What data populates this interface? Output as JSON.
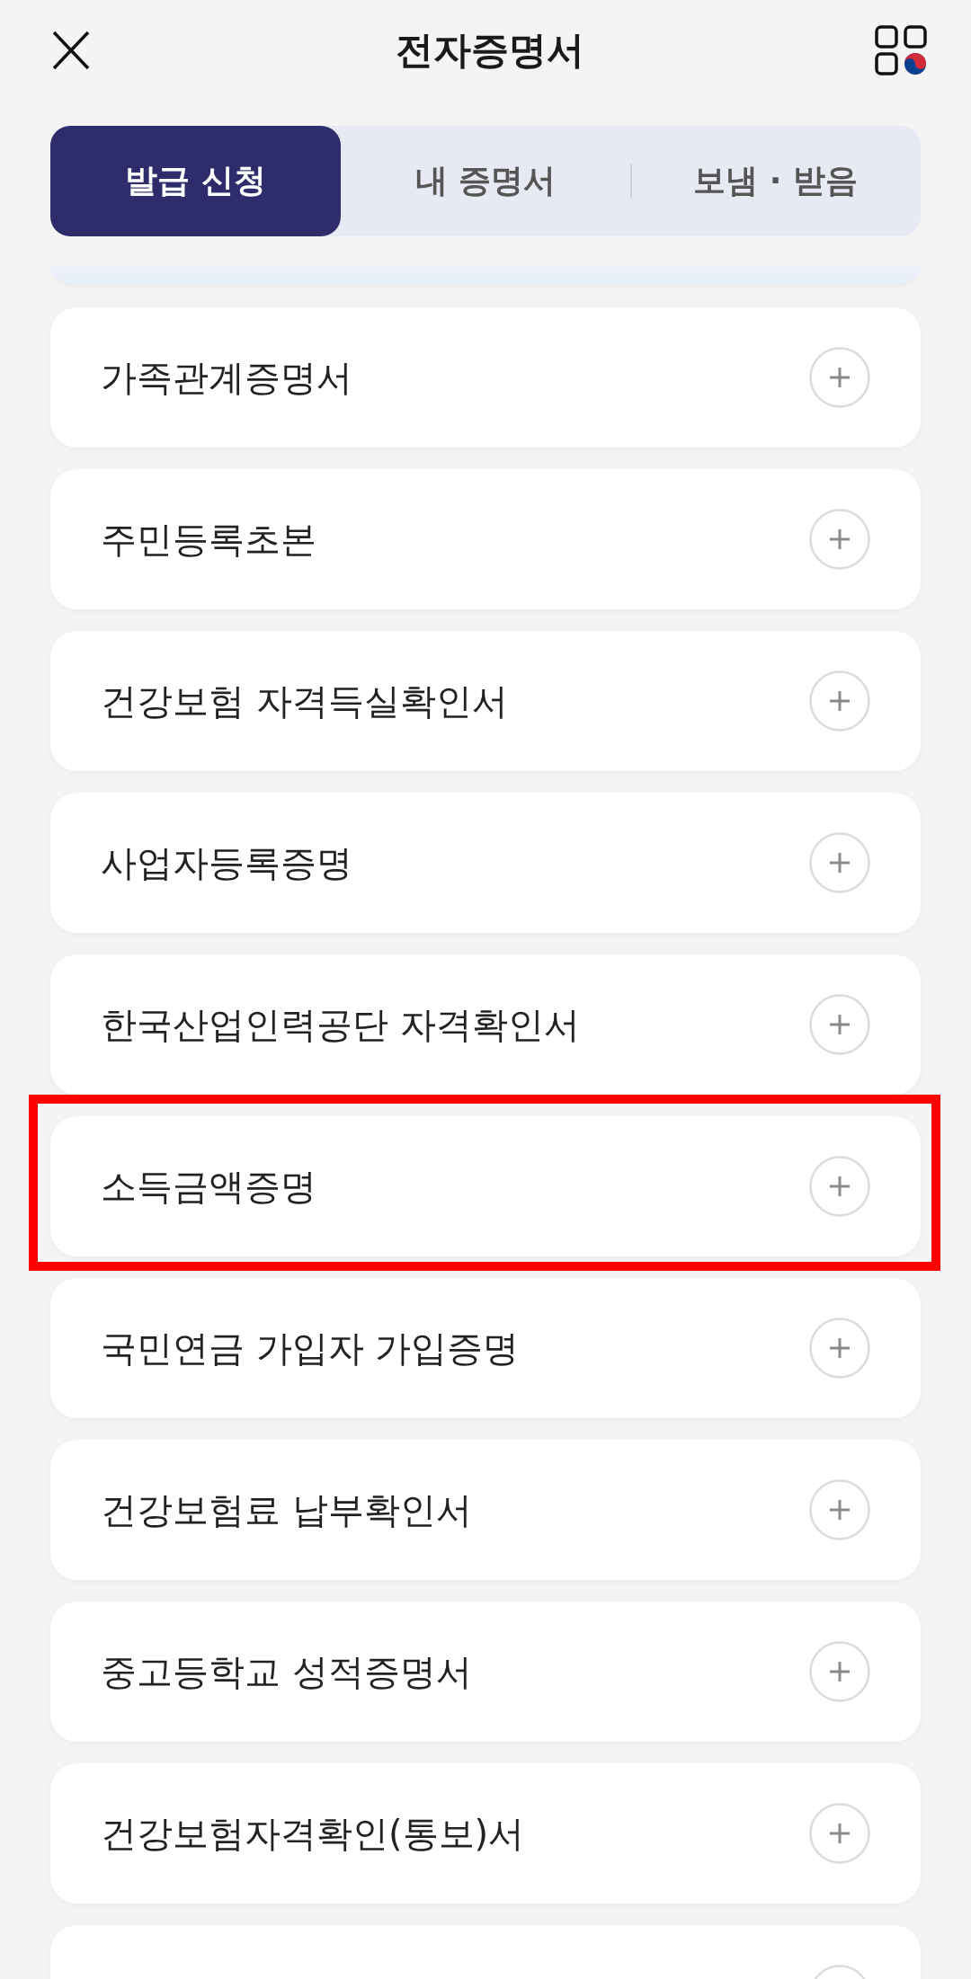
{
  "header": {
    "title": "전자증명서"
  },
  "tabs": [
    {
      "label": "발급 신청",
      "selected": true
    },
    {
      "label": "내 증명서",
      "selected": false
    },
    {
      "label": "보냄 · 받음",
      "selected": false
    }
  ],
  "certificates": {
    "clipped_card_above": true,
    "items": [
      {
        "label": "가족관계증명서",
        "highlighted": false
      },
      {
        "label": "주민등록초본",
        "highlighted": false
      },
      {
        "label": "건강보험 자격득실확인서",
        "highlighted": false
      },
      {
        "label": "사업자등록증명",
        "highlighted": false
      },
      {
        "label": "한국산업인력공단 자격확인서",
        "highlighted": false
      },
      {
        "label": "소득금액증명",
        "highlighted": true
      },
      {
        "label": "국민연금 가입자 가입증명",
        "highlighted": false
      },
      {
        "label": "건강보험료 납부확인서",
        "highlighted": false
      },
      {
        "label": "중고등학교 성적증명서",
        "highlighted": false
      },
      {
        "label": "건강보험자격확인(통보)서",
        "highlighted": false
      }
    ],
    "clipped_card_below": true
  }
}
